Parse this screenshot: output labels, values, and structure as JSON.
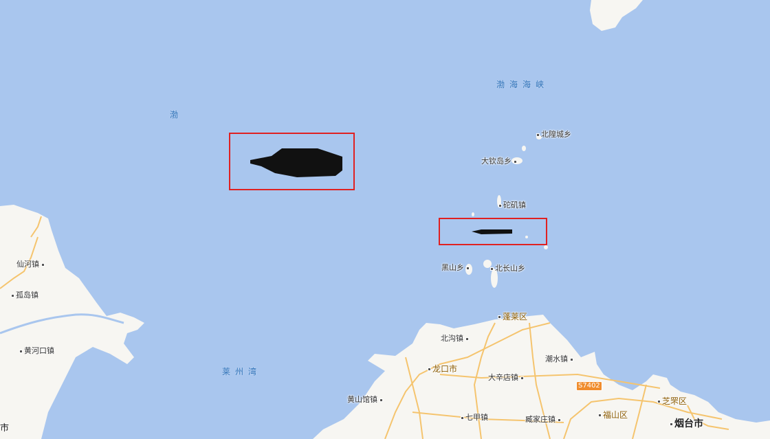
{
  "colors": {
    "water": "#a9c6ee",
    "land": "#f7f6f2",
    "road": "#f5c46e",
    "box": "#e02020",
    "vessel": "#111111"
  },
  "labels": {
    "bohai": "渤",
    "bohai_strait": "渤海海峡",
    "laizhou_bay": "莱州湾",
    "beihuangcheng": "北隍城乡",
    "daqindao": "大钦岛乡",
    "tuoji": "砣矶镇",
    "heishan": "黑山乡",
    "beichangshan": "北长山乡",
    "penglai": "蓬莱区",
    "beigou": "北沟镇",
    "longkou": "龙口市",
    "daxindian": "大辛店镇",
    "chaoshui": "潮水镇",
    "huangshanguan": "黄山馆镇",
    "xianhe": "仙河镇",
    "gudao": "孤岛镇",
    "huanghekou": "黄河口镇",
    "qijia": "七甲镇",
    "zangjiazhuang": "臧家庄镇",
    "fushan": "福山区",
    "zhifu": "芝罘区",
    "yantai": "烟台市",
    "left_city_fragment": "市",
    "road_s7402": "S7402"
  }
}
